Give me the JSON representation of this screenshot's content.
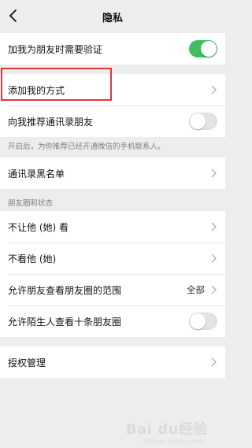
{
  "nav": {
    "title": "隐私"
  },
  "group1": {
    "verify_label": "加我为朋友时需要验证",
    "verify_on": true
  },
  "group2": {
    "add_methods_label": "添加我的方式",
    "recommend_label": "向我推荐通讯录朋友",
    "recommend_on": false,
    "recommend_hint": "开启后，为你推荐已经开通微信的手机联系人。"
  },
  "group3": {
    "blacklist_label": "通讯录黑名单"
  },
  "moments_section": {
    "header": "朋友圈和状态",
    "dont_let_see_label": "不让他 (她) 看",
    "dont_see_label": "不看他 (她)",
    "range_label": "允许朋友查看朋友圈的范围",
    "range_value": "全部",
    "stranger_label": "允许陌生人查看十条朋友圈",
    "stranger_on": false
  },
  "group5": {
    "auth_label": "授权管理"
  },
  "watermark": {
    "text": "Bai du经验",
    "sub": "jingyan.baidu.com"
  },
  "colors": {
    "toggle_on": "#3fbf63",
    "highlight": "#d93a3a"
  }
}
